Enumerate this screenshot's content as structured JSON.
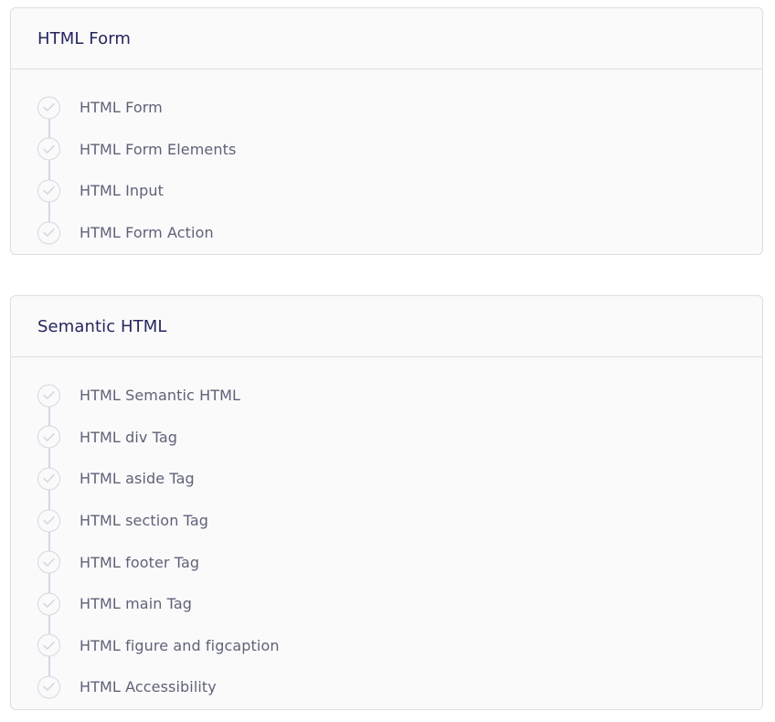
{
  "sections": [
    {
      "title": "HTML Form",
      "lessons": [
        {
          "label": "HTML Form"
        },
        {
          "label": "HTML Form Elements"
        },
        {
          "label": "HTML Input"
        },
        {
          "label": "HTML Form Action"
        }
      ]
    },
    {
      "title": "Semantic HTML",
      "lessons": [
        {
          "label": "HTML Semantic HTML"
        },
        {
          "label": "HTML div Tag"
        },
        {
          "label": "HTML aside Tag"
        },
        {
          "label": "HTML section Tag"
        },
        {
          "label": "HTML footer Tag"
        },
        {
          "label": "HTML main Tag"
        },
        {
          "label": "HTML figure and figcaption"
        },
        {
          "label": "HTML Accessibility"
        }
      ]
    }
  ],
  "colors": {
    "card_bg": "#fafafb",
    "border": "#dcdee4",
    "title": "#25265e",
    "lesson_text": "#5f6277",
    "check_stroke": "#d5d8e2"
  },
  "icons": {
    "lesson_status": "check-circle-icon"
  }
}
